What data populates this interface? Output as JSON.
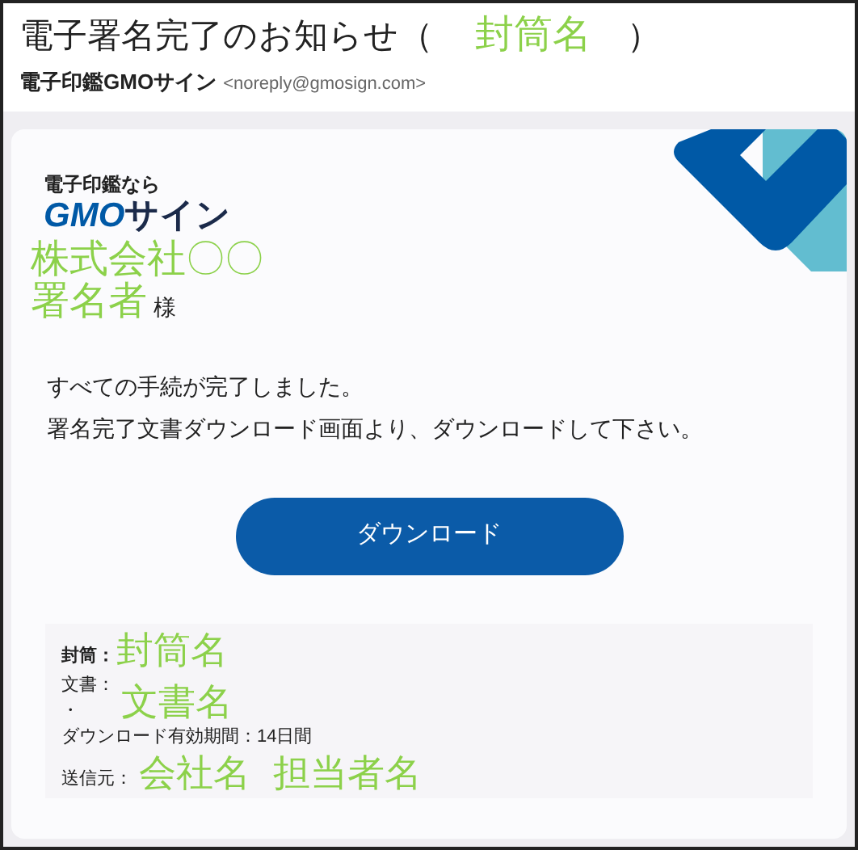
{
  "email": {
    "subject_prefix": "電子署名完了のお知らせ（",
    "subject_name": "封筒名",
    "subject_suffix": "）",
    "sender_name": "電子印鑑GMOサイン",
    "sender_address": "<noreply@gmosign.com>"
  },
  "logo": {
    "tagline": "電子印鑑なら",
    "brand_latin": "GMO",
    "brand_kana": "サイン"
  },
  "recipient": {
    "company": "株式会社〇〇",
    "name": "署名者",
    "honorific": "様"
  },
  "message": [
    "すべての手続が完了しました。",
    "署名完了文書ダウンロード画面より、ダウンロードして下さい。"
  ],
  "download_button": "ダウンロード",
  "details": [
    {
      "kind": "envelope",
      "label": "封筒：",
      "value": "封筒名"
    },
    {
      "kind": "documents",
      "label": "文書：",
      "bullet": "・",
      "value": "文書名"
    },
    {
      "kind": "text",
      "text": "ダウンロード有効期間：14日間"
    },
    {
      "kind": "sender",
      "label": "送信元：",
      "values": [
        "会社名",
        "担当者名"
      ]
    }
  ]
}
